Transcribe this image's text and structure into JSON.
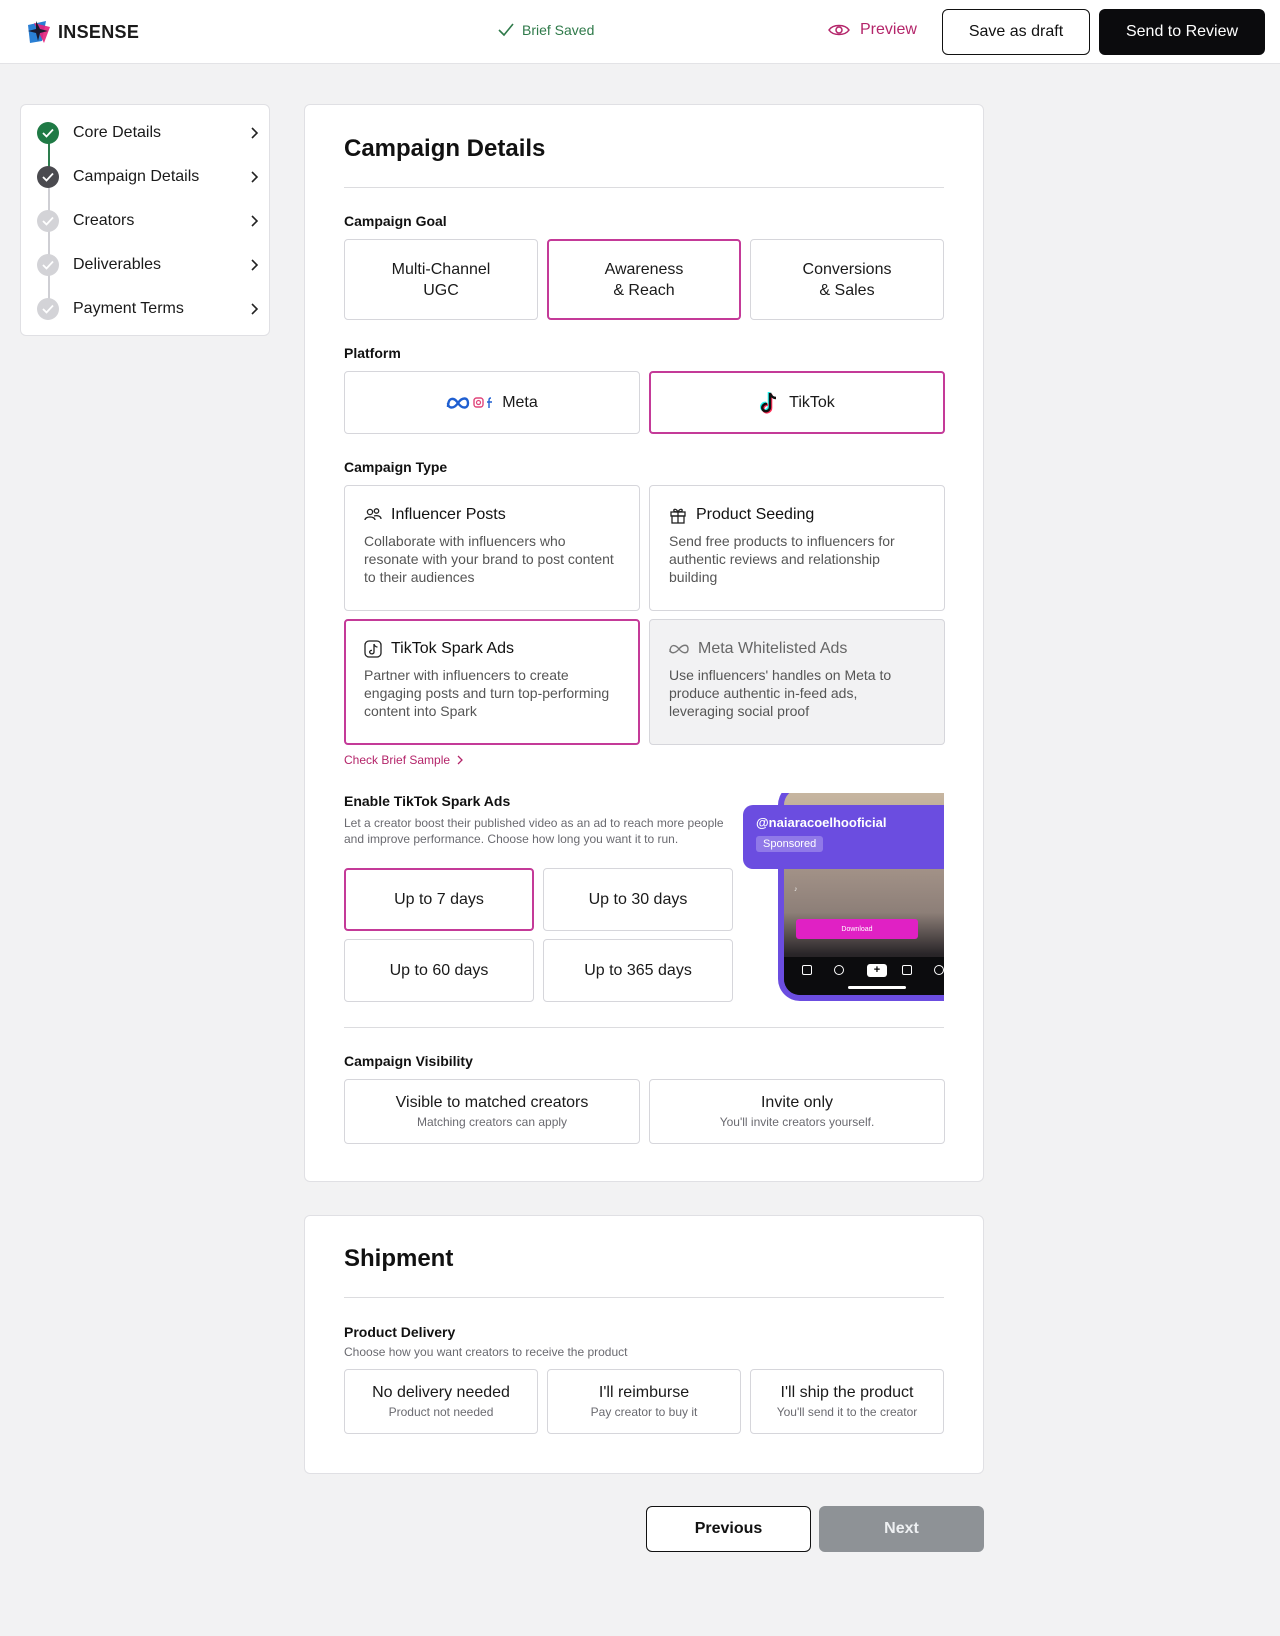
{
  "header": {
    "logo_text": "INSENSE",
    "status": "Brief Saved",
    "preview": "Preview",
    "save_draft": "Save as draft",
    "send_review": "Send to Review"
  },
  "sidebar": {
    "steps": [
      {
        "label": "Core Details",
        "state": "complete"
      },
      {
        "label": "Campaign Details",
        "state": "current"
      },
      {
        "label": "Creators",
        "state": "pending"
      },
      {
        "label": "Deliverables",
        "state": "pending"
      },
      {
        "label": "Payment Terms",
        "state": "pending"
      }
    ]
  },
  "campaign": {
    "title": "Campaign Details",
    "goal": {
      "label": "Campaign Goal",
      "options": [
        {
          "line1": "Multi-Channel",
          "line2": "UGC",
          "selected": false
        },
        {
          "line1": "Awareness",
          "line2": "& Reach",
          "selected": true
        },
        {
          "line1": "Conversions",
          "line2": "& Sales",
          "selected": false
        }
      ]
    },
    "platform": {
      "label": "Platform",
      "options": [
        {
          "label": "Meta",
          "icon": "meta-logo-icon",
          "selected": false
        },
        {
          "label": "TikTok",
          "icon": "tiktok-logo-icon",
          "selected": true
        }
      ]
    },
    "type": {
      "label": "Campaign Type",
      "options": [
        {
          "title": "Influencer Posts",
          "icon": "people-icon",
          "desc": "Collaborate with influencers who resonate with your brand to post content to their audiences",
          "selected": false,
          "disabled": false
        },
        {
          "title": "Product Seeding",
          "icon": "gift-icon",
          "desc": "Send free products to influencers for authentic reviews and relationship building",
          "selected": false,
          "disabled": false
        },
        {
          "title": "TikTok Spark Ads",
          "icon": "tiktok-icon",
          "desc": "Partner with influencers to create engaging posts and turn top-performing content into Spark",
          "selected": true,
          "disabled": false
        },
        {
          "title": "Meta Whitelisted Ads",
          "icon": "meta-icon",
          "desc": "Use influencers' handles on Meta to produce authentic in-feed ads, leveraging social proof",
          "selected": false,
          "disabled": true
        }
      ]
    },
    "brief_link": "Check Brief Sample",
    "spark": {
      "label": "Enable TikTok Spark Ads",
      "desc": "Let a creator boost their published video as an ad to reach more people and improve performance. Choose how long you want it to run.",
      "options": [
        {
          "label": "Up to 7 days",
          "selected": true
        },
        {
          "label": "Up to 30 days",
          "selected": false
        },
        {
          "label": "Up to 60 days",
          "selected": false
        },
        {
          "label": "Up to 365 days",
          "selected": false
        }
      ],
      "preview": {
        "handle": "@naiaracoelhooficial",
        "badge": "Sponsored",
        "cta": "Download"
      }
    },
    "visibility": {
      "label": "Campaign Visibility",
      "options": [
        {
          "title": "Visible to matched creators",
          "sub": "Matching creators can apply",
          "selected": false
        },
        {
          "title": "Invite only",
          "sub": "You'll invite creators yourself.",
          "selected": false
        }
      ]
    }
  },
  "shipment": {
    "title": "Shipment",
    "delivery": {
      "label": "Product Delivery",
      "sub": "Choose how you want creators to receive the product",
      "options": [
        {
          "title": "No delivery needed",
          "sub": "Product not needed"
        },
        {
          "title": "I'll reimburse",
          "sub": "Pay creator to buy it"
        },
        {
          "title": "I'll ship the product",
          "sub": "You'll send it to the creator"
        }
      ]
    }
  },
  "footer": {
    "previous": "Previous",
    "next": "Next"
  },
  "colors": {
    "accent": "#c43a98",
    "complete": "#1f7a45",
    "primary_button": "#0b0b0d",
    "disabled_button": "#8e9296"
  }
}
